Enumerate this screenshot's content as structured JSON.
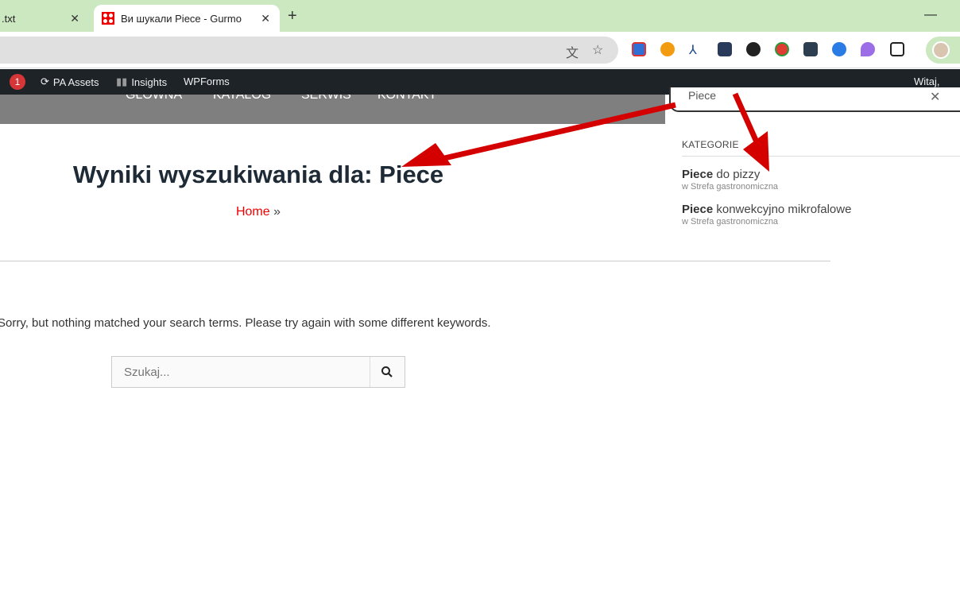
{
  "browser": {
    "tabs": [
      {
        "label": ".txt"
      },
      {
        "label": "Ви шукали Piece - Gurmo"
      }
    ]
  },
  "adminbar": {
    "notif_count": "1",
    "items": [
      "PA Assets",
      "Insights",
      "WPForms"
    ],
    "greeting": "Witaj, adm"
  },
  "nav": {
    "items": [
      "GŁÓWNA",
      "KATALOG",
      "SERWIS",
      "KONTAKT"
    ]
  },
  "search_popup": {
    "value": "Piece",
    "section": "KATEGORIE",
    "results": [
      {
        "match": "Piece",
        "rest": " do pizzy",
        "sub": "w Strefa gastronomiczna"
      },
      {
        "match": "Piece",
        "rest": " konwekcyjno mikrofalowe",
        "sub": "w Strefa gastronomiczna"
      }
    ]
  },
  "main": {
    "title": "Wyniki wyszukiwania dla: Piece",
    "breadcrumb_home": "Home",
    "breadcrumb_sep": "»",
    "message": "Sorry, but nothing matched your search terms. Please try again with some different keywords.",
    "search_placeholder": "Szukaj..."
  },
  "colors": {
    "annotation": "#d40000",
    "accent": "#e00000"
  }
}
